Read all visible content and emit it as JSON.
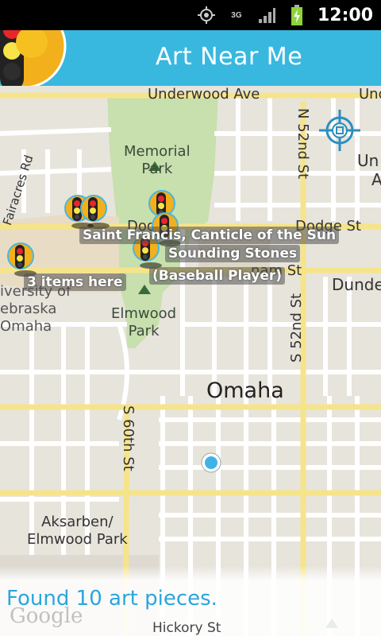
{
  "status_bar": {
    "time": "12:00",
    "network": "3G",
    "icons": [
      "gps-icon",
      "3g-icon",
      "signal-icon",
      "battery-charging-icon"
    ]
  },
  "app_bar": {
    "title": "Art Near Me",
    "logo_icon": "traffic-light-logo-icon"
  },
  "map": {
    "streets": {
      "underwood_top": "Underwood Ave",
      "underwood_right": "Und",
      "n52nd": "N 52nd St",
      "faircres": "Fairacres Rd",
      "dodge_left": "Dod",
      "dodge_right": "Dodge St",
      "farnam": "nam St",
      "s52nd": "S 52nd St",
      "s60th": "S 60th St",
      "hickory": "Hickory St",
      "right_un": "Un",
      "right_a": "A"
    },
    "places": {
      "memorial_park": "Memorial\nPark",
      "elmwood_park": "Elmwood\nPark",
      "university": "iversity of\nebraska\nOmaha",
      "city": "Omaha",
      "aksarben": "Aksarben/\nElmwood Park",
      "dundee": "Dunde"
    },
    "markers": {
      "tag_saint": "Saint Francis, Canticle of the Sun",
      "tag_sounding": "Sounding Stones",
      "tag_baseball": "(Baseball Player)",
      "tag_items": "3 items here"
    },
    "colors": {
      "road": "#ffffff",
      "major_road": "#f6e48a",
      "park": "#c8dfae",
      "campus": "#e8dcc4",
      "accent": "#38b8df"
    },
    "watermark": "Google"
  },
  "footer": {
    "status_text": "Found 10 art pieces."
  }
}
